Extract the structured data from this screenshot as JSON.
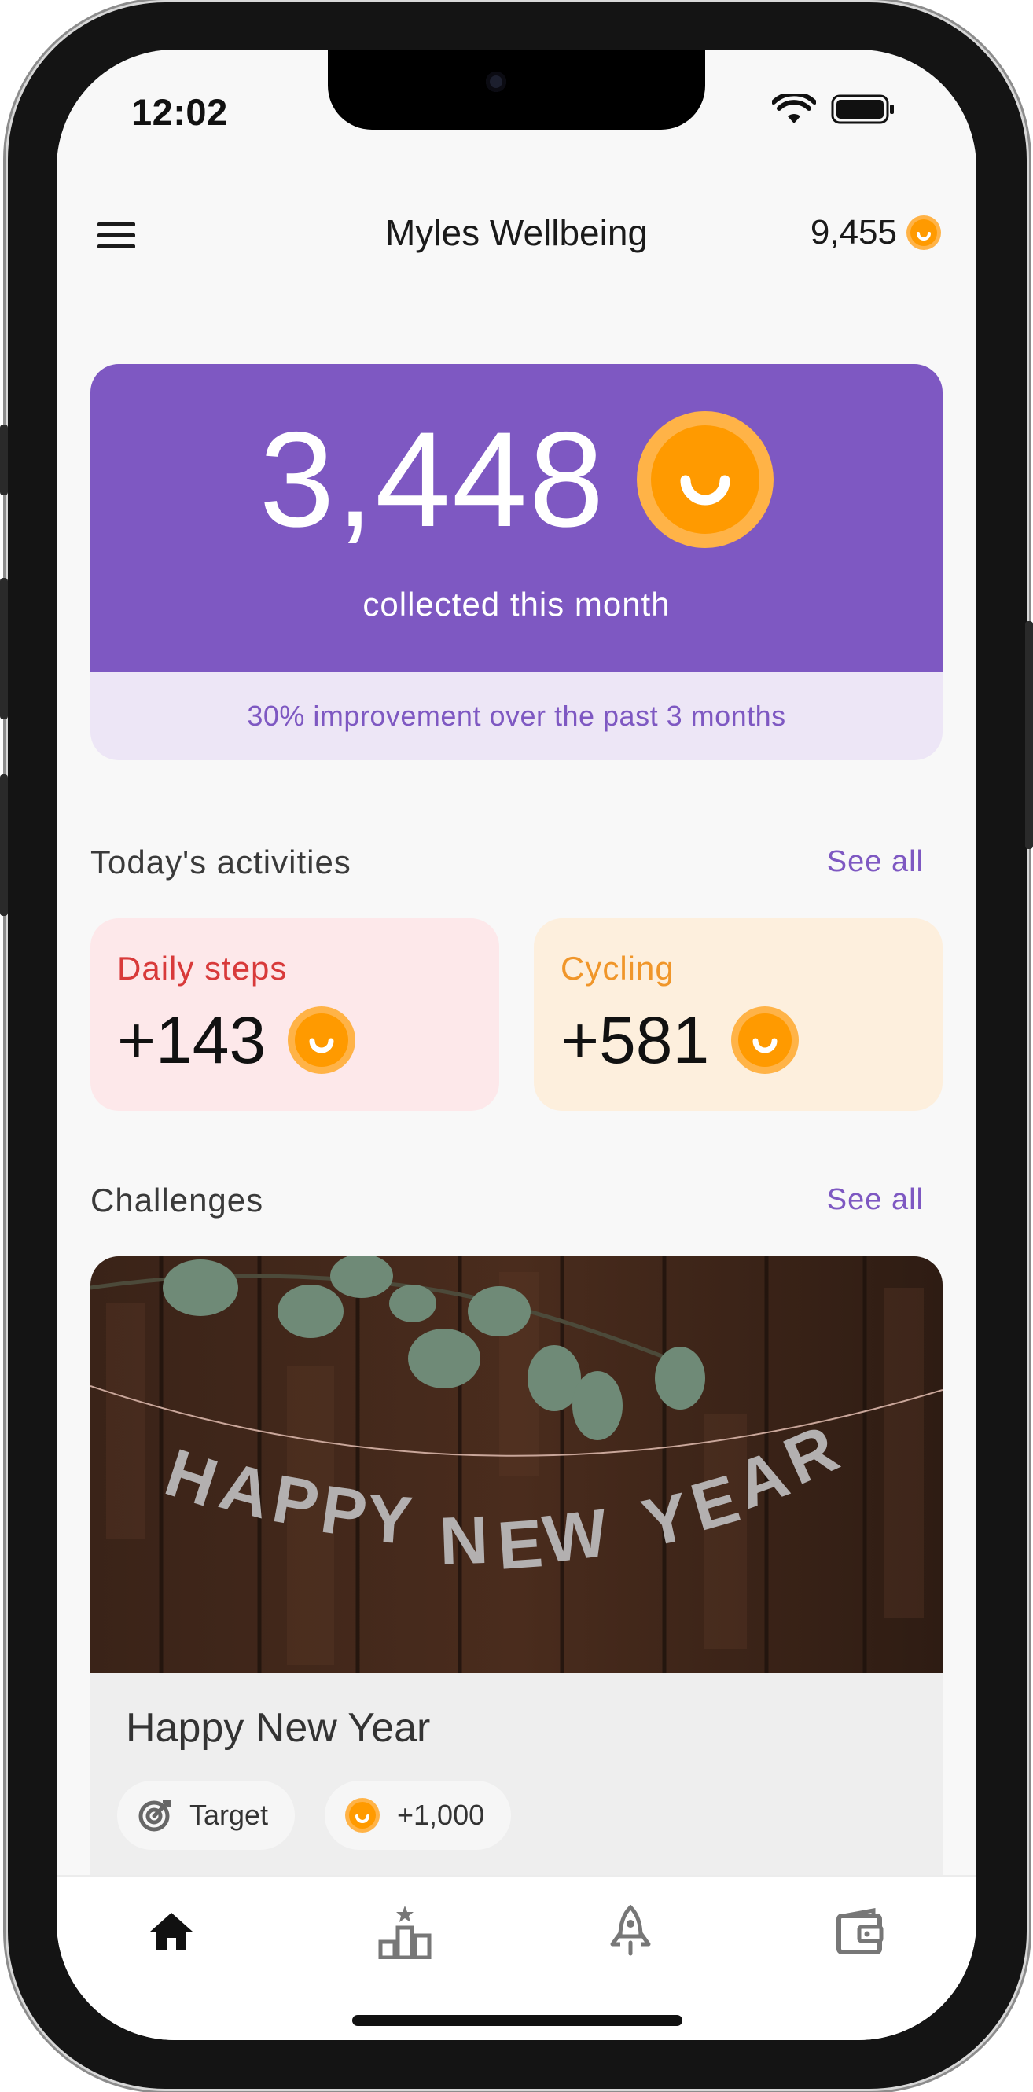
{
  "status_bar": {
    "time": "12:02",
    "icons": [
      "wifi-icon",
      "battery-icon"
    ]
  },
  "header": {
    "menu_icon": "menu-icon",
    "title": "Myles Wellbeing",
    "balance": "9,455",
    "balance_icon": "coin-icon"
  },
  "hero": {
    "value": "3,448",
    "caption": "collected this month",
    "footer": "30% improvement over the past 3 months"
  },
  "activities": {
    "title": "Today's activities",
    "see_all": "See all",
    "items": [
      {
        "label": "Daily steps",
        "value": "+143",
        "color": "#d83a3a",
        "background": "#fde8ea"
      },
      {
        "label": "Cycling",
        "value": "+581",
        "color": "#f0962a",
        "background": "#fdefdd"
      }
    ]
  },
  "challenges": {
    "title": "Challenges",
    "see_all": "See all",
    "card": {
      "image_text": "HAPPY NEW YEAR",
      "title": "Happy New Year",
      "chips": [
        {
          "icon": "target-icon",
          "label": "Target"
        },
        {
          "icon": "coin-icon",
          "label": "+1,000"
        }
      ]
    }
  },
  "bottom_nav": {
    "items": [
      {
        "icon": "home-icon",
        "active": true
      },
      {
        "icon": "leaderboard-icon",
        "active": false
      },
      {
        "icon": "rocket-icon",
        "active": false
      },
      {
        "icon": "wallet-icon",
        "active": false
      }
    ]
  },
  "colors": {
    "accent": "#7e58c2",
    "accent_light": "#ede6f6",
    "coin": "#ff9a00",
    "coin_ring": "#ffb347",
    "background": "#f8f8f8"
  }
}
